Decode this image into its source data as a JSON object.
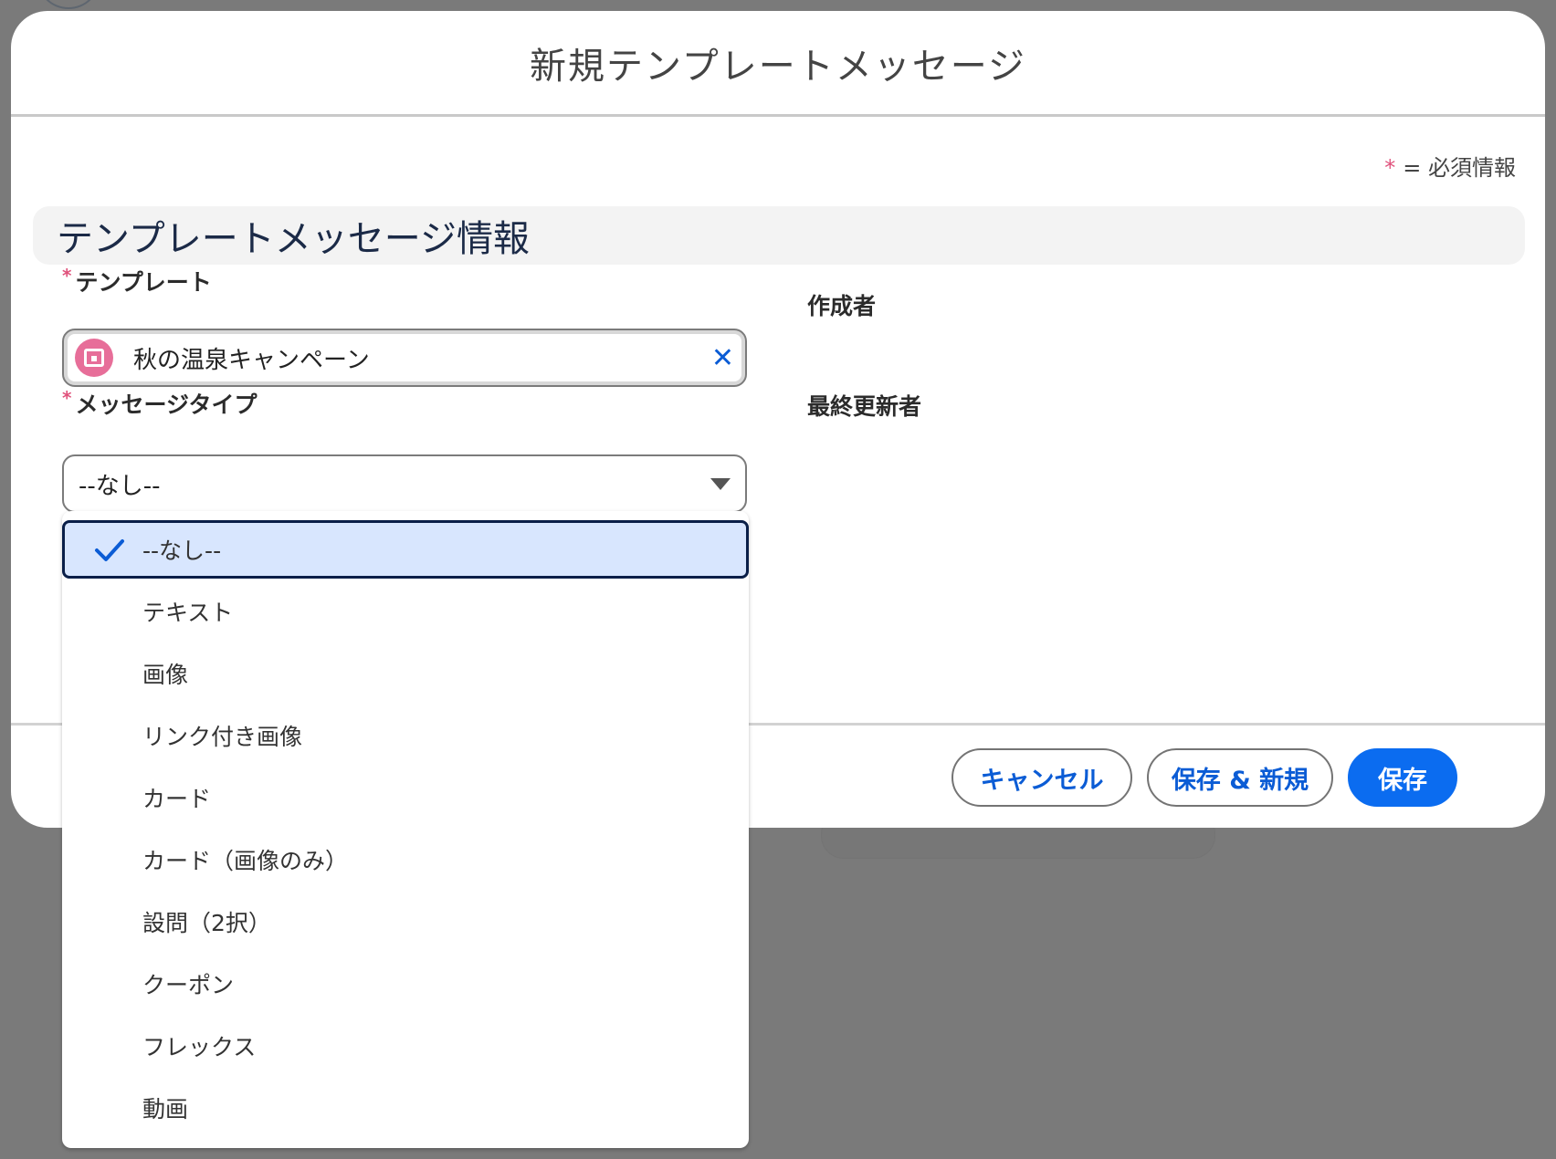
{
  "modal": {
    "title": "新規テンプレートメッセージ",
    "required_note_star": "*",
    "required_note": "= 必須情報"
  },
  "section": {
    "title": "テンプレートメッセージ情報"
  },
  "fields": {
    "template": {
      "required_mark": "*",
      "label": "テンプレート",
      "value": "秋の温泉キャンペーン",
      "record_icon": "record-icon",
      "clear_icon": "close-icon"
    },
    "message_type": {
      "required_mark": "*",
      "label": "メッセージタイプ",
      "selected": "--なし--",
      "caret_icon": "chevron-down-icon"
    },
    "created_by": {
      "label": "作成者"
    },
    "last_modified_by": {
      "label": "最終更新者"
    }
  },
  "dropdown": {
    "check_icon": "check-icon",
    "options": [
      "--なし--",
      "テキスト",
      "画像",
      "リンク付き画像",
      "カード",
      "カード（画像のみ）",
      "設問（2択）",
      "クーポン",
      "フレックス",
      "動画"
    ]
  },
  "buttons": {
    "cancel": "キャンセル",
    "save_new": "保存 & 新規",
    "save": "保存"
  },
  "colors": {
    "accent": "#0b6cf0",
    "required_star": "#e0527c",
    "record_icon_bg": "#e76e99",
    "selected_option_bg": "#d8e6fe"
  }
}
